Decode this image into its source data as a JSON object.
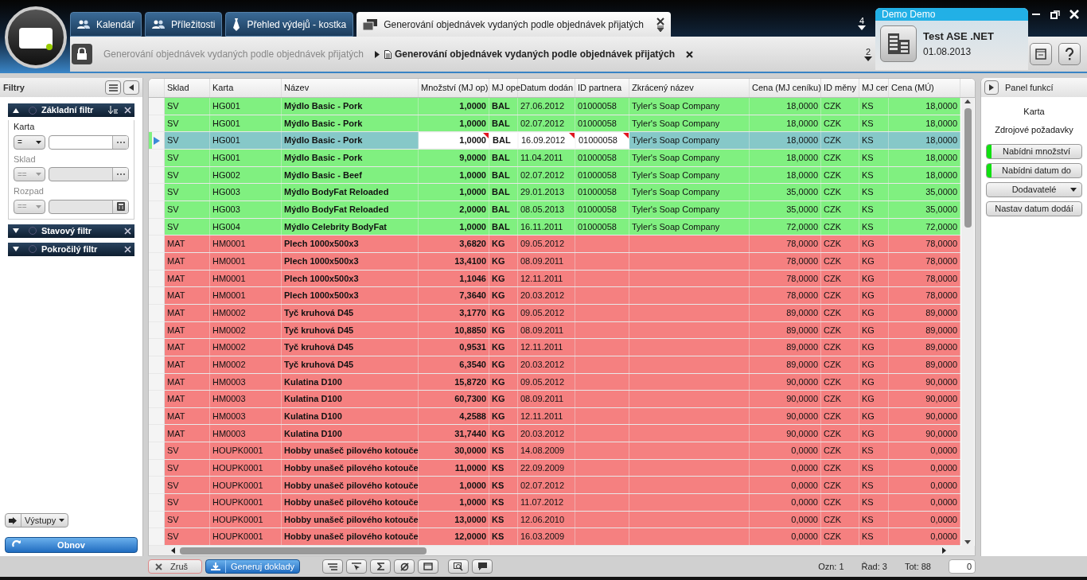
{
  "tabs": [
    {
      "label": "Kalendář",
      "kind": "people",
      "selected": false
    },
    {
      "label": "Příležitosti",
      "kind": "people",
      "selected": false
    },
    {
      "label": "Přehled výdejů - kostka",
      "kind": "tie",
      "selected": false
    },
    {
      "label": "Generování objednávek vydaných podle objednávek přijatých",
      "kind": "windows",
      "selected": true
    }
  ],
  "tab_count": "4",
  "breadcrumb": [
    "Generování objednávek vydaných podle objednávek přijatých",
    "Generování objednávek vydaných podle objednávek přijatých"
  ],
  "breadcrumb_count": "2",
  "user": {
    "name": "Demo Demo",
    "company": "Test ASE .NET",
    "date": "01.08.2013"
  },
  "filters": {
    "title": "Filtry",
    "sections": [
      {
        "title": "Základní filtr",
        "expanded": true,
        "fields": [
          {
            "label": "Karta",
            "operator": "=",
            "disabled": false,
            "kind": "ellipsis"
          },
          {
            "label": "Sklad",
            "operator": "==",
            "disabled": true,
            "kind": "ellipsis"
          },
          {
            "label": "Rozpad",
            "operator": "==",
            "disabled": true,
            "kind": "calculator"
          }
        ]
      },
      {
        "title": "Stavový filtr",
        "expanded": false
      },
      {
        "title": "Pokročilý filtr",
        "expanded": false
      }
    ],
    "outputs_button": "Výstupy",
    "refresh_button": "Obnov"
  },
  "table": {
    "columns": [
      "Sklad",
      "Karta",
      "Název",
      "Množství (MJ op)",
      "MJ ope",
      "Datum dodán",
      "ID partnera",
      "Zkrácený název",
      "Cena (MJ ceníku)",
      "ID měny",
      "MJ cer",
      "Cena (MÚ)"
    ],
    "rows": [
      {
        "kind": "ok",
        "selected": false,
        "cells": [
          "SV",
          "HG001",
          "Mýdlo Basic - Pork",
          "1,0000",
          "BAL",
          "27.06.2012",
          "01000058",
          "Tyler's Soap Company",
          "18,0000",
          "CZK",
          "KS",
          "18,0000"
        ]
      },
      {
        "kind": "ok",
        "selected": false,
        "cells": [
          "SV",
          "HG001",
          "Mýdlo Basic - Pork",
          "1,0000",
          "BAL",
          "02.07.2012",
          "01000058",
          "Tyler's Soap Company",
          "18,0000",
          "CZK",
          "KS",
          "18,0000"
        ]
      },
      {
        "kind": "ok",
        "selected": true,
        "cells": [
          "SV",
          "HG001",
          "Mýdlo Basic - Pork",
          "1,0000",
          "BAL",
          "16.09.2012",
          "01000058",
          "Tyler's Soap Company",
          "18,0000",
          "CZK",
          "KS",
          "18,0000"
        ]
      },
      {
        "kind": "ok",
        "selected": false,
        "cells": [
          "SV",
          "HG001",
          "Mýdlo Basic - Pork",
          "9,0000",
          "BAL",
          "11.04.2011",
          "01000058",
          "Tyler's Soap Company",
          "18,0000",
          "CZK",
          "KS",
          "18,0000"
        ]
      },
      {
        "kind": "ok",
        "selected": false,
        "cells": [
          "SV",
          "HG002",
          "Mýdlo Basic - Beef",
          "1,0000",
          "BAL",
          "02.07.2012",
          "01000058",
          "Tyler's Soap Company",
          "18,0000",
          "CZK",
          "KS",
          "18,0000"
        ]
      },
      {
        "kind": "ok",
        "selected": false,
        "cells": [
          "SV",
          "HG003",
          "Mýdlo BodyFat Reloaded",
          "1,0000",
          "BAL",
          "29.01.2013",
          "01000058",
          "Tyler's Soap Company",
          "35,0000",
          "CZK",
          "KS",
          "35,0000"
        ]
      },
      {
        "kind": "ok",
        "selected": false,
        "cells": [
          "SV",
          "HG003",
          "Mýdlo BodyFat Reloaded",
          "2,0000",
          "BAL",
          "08.05.2013",
          "01000058",
          "Tyler's Soap Company",
          "35,0000",
          "CZK",
          "KS",
          "35,0000"
        ]
      },
      {
        "kind": "ok",
        "selected": false,
        "cells": [
          "SV",
          "HG004",
          "Mýdlo Celebrity BodyFat",
          "1,0000",
          "BAL",
          "16.11.2011",
          "01000058",
          "Tyler's Soap Company",
          "72,0000",
          "CZK",
          "KS",
          "72,0000"
        ]
      },
      {
        "kind": "missing",
        "selected": false,
        "cells": [
          "MAT",
          "HM0001",
          "Plech 1000x500x3",
          "3,6820",
          "KG",
          "09.05.2012",
          "",
          "",
          "78,0000",
          "CZK",
          "KG",
          "78,0000"
        ]
      },
      {
        "kind": "missing",
        "selected": false,
        "cells": [
          "MAT",
          "HM0001",
          "Plech 1000x500x3",
          "13,4100",
          "KG",
          "08.09.2011",
          "",
          "",
          "78,0000",
          "CZK",
          "KG",
          "78,0000"
        ]
      },
      {
        "kind": "missing",
        "selected": false,
        "cells": [
          "MAT",
          "HM0001",
          "Plech 1000x500x3",
          "1,1046",
          "KG",
          "12.11.2011",
          "",
          "",
          "78,0000",
          "CZK",
          "KG",
          "78,0000"
        ]
      },
      {
        "kind": "missing",
        "selected": false,
        "cells": [
          "MAT",
          "HM0001",
          "Plech 1000x500x3",
          "7,3640",
          "KG",
          "20.03.2012",
          "",
          "",
          "78,0000",
          "CZK",
          "KG",
          "78,0000"
        ]
      },
      {
        "kind": "missing",
        "selected": false,
        "cells": [
          "MAT",
          "HM0002",
          "Tyč kruhová D45",
          "3,1770",
          "KG",
          "09.05.2012",
          "",
          "",
          "89,0000",
          "CZK",
          "KG",
          "89,0000"
        ]
      },
      {
        "kind": "missing",
        "selected": false,
        "cells": [
          "MAT",
          "HM0002",
          "Tyč kruhová D45",
          "10,8850",
          "KG",
          "08.09.2011",
          "",
          "",
          "89,0000",
          "CZK",
          "KG",
          "89,0000"
        ]
      },
      {
        "kind": "missing",
        "selected": false,
        "cells": [
          "MAT",
          "HM0002",
          "Tyč kruhová D45",
          "0,9531",
          "KG",
          "12.11.2011",
          "",
          "",
          "89,0000",
          "CZK",
          "KG",
          "89,0000"
        ]
      },
      {
        "kind": "missing",
        "selected": false,
        "cells": [
          "MAT",
          "HM0002",
          "Tyč kruhová D45",
          "6,3540",
          "KG",
          "20.03.2012",
          "",
          "",
          "89,0000",
          "CZK",
          "KG",
          "89,0000"
        ]
      },
      {
        "kind": "missing",
        "selected": false,
        "cells": [
          "MAT",
          "HM0003",
          "Kulatina D100",
          "15,8720",
          "KG",
          "09.05.2012",
          "",
          "",
          "90,0000",
          "CZK",
          "KG",
          "90,0000"
        ]
      },
      {
        "kind": "missing",
        "selected": false,
        "cells": [
          "MAT",
          "HM0003",
          "Kulatina D100",
          "60,7300",
          "KG",
          "08.09.2011",
          "",
          "",
          "90,0000",
          "CZK",
          "KG",
          "90,0000"
        ]
      },
      {
        "kind": "missing",
        "selected": false,
        "cells": [
          "MAT",
          "HM0003",
          "Kulatina D100",
          "4,2588",
          "KG",
          "12.11.2011",
          "",
          "",
          "90,0000",
          "CZK",
          "KG",
          "90,0000"
        ]
      },
      {
        "kind": "missing",
        "selected": false,
        "cells": [
          "MAT",
          "HM0003",
          "Kulatina D100",
          "31,7440",
          "KG",
          "20.03.2012",
          "",
          "",
          "90,0000",
          "CZK",
          "KG",
          "90,0000"
        ]
      },
      {
        "kind": "missing",
        "selected": false,
        "cells": [
          "SV",
          "HOUPK0001",
          "Hobby unašeč pilového kotouče",
          "30,0000",
          "KS",
          "14.08.2009",
          "",
          "",
          "0,0000",
          "CZK",
          "KS",
          "0,0000"
        ]
      },
      {
        "kind": "missing",
        "selected": false,
        "cells": [
          "SV",
          "HOUPK0001",
          "Hobby unašeč pilového kotouče",
          "11,0000",
          "KS",
          "22.09.2009",
          "",
          "",
          "0,0000",
          "CZK",
          "KS",
          "0,0000"
        ]
      },
      {
        "kind": "missing",
        "selected": false,
        "cells": [
          "SV",
          "HOUPK0001",
          "Hobby unašeč pilového kotouče",
          "1,0000",
          "KS",
          "02.07.2012",
          "",
          "",
          "0,0000",
          "CZK",
          "KS",
          "0,0000"
        ]
      },
      {
        "kind": "missing",
        "selected": false,
        "cells": [
          "SV",
          "HOUPK0001",
          "Hobby unašeč pilového kotouče",
          "1,0000",
          "KS",
          "11.07.2012",
          "",
          "",
          "0,0000",
          "CZK",
          "KS",
          "0,0000"
        ]
      },
      {
        "kind": "missing",
        "selected": false,
        "cells": [
          "SV",
          "HOUPK0001",
          "Hobby unašeč pilového kotouče",
          "13,0000",
          "KS",
          "12.06.2010",
          "",
          "",
          "0,0000",
          "CZK",
          "KS",
          "0,0000"
        ]
      },
      {
        "kind": "missing",
        "selected": false,
        "cells": [
          "SV",
          "HOUPK0001",
          "Hobby unašeč pilového kotouče",
          "12,0000",
          "KS",
          "16.03.2009",
          "",
          "",
          "0,0000",
          "CZK",
          "KS",
          "0,0000"
        ]
      }
    ]
  },
  "bottom_bar": {
    "cancel_button": "Zruš",
    "generate_button": "Generuj doklady",
    "status": [
      "Ozn: 1",
      "Řad: 3",
      "Tot: 88"
    ],
    "counter_value": "0"
  },
  "function_panel": {
    "title": "Panel funkcí",
    "labels": [
      "Karta",
      "Zdrojové požadavky"
    ],
    "buttons": [
      {
        "label": "Nabídni množství",
        "kind": "indicator"
      },
      {
        "label": "Nabídni datum do",
        "kind": "indicator"
      },
      {
        "label": "Dodavatelé",
        "kind": "dropdown"
      },
      {
        "label": "Nastav datum dodáí",
        "kind": "plain"
      }
    ]
  }
}
